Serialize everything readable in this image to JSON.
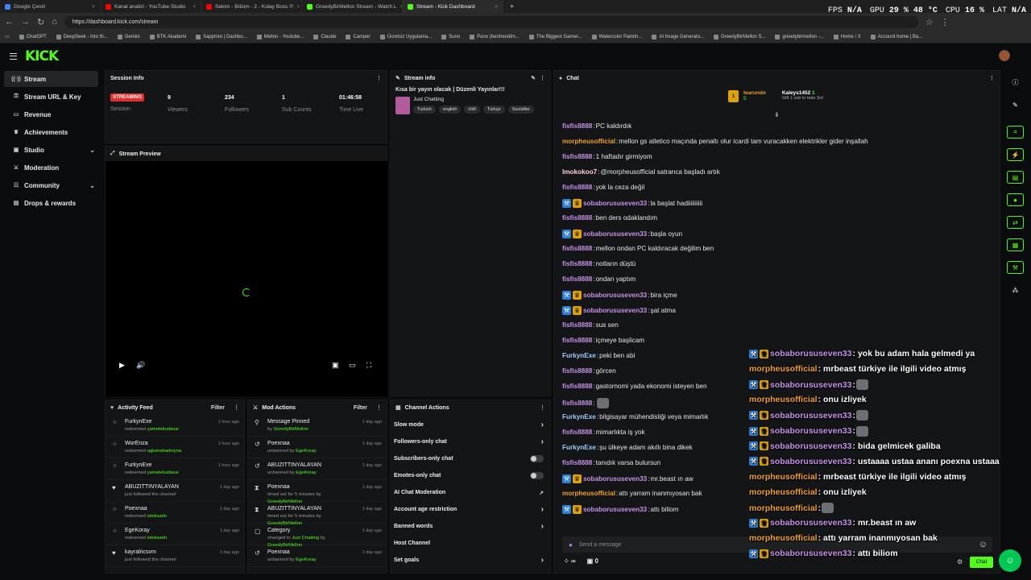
{
  "browser": {
    "tabs": [
      {
        "title": "Google Çeviri",
        "color": "#4285f4"
      },
      {
        "title": "Kanal analizi - YouTube Studio",
        "color": "#ff0000"
      },
      {
        "title": "Sekiro - Bölüm - 2 - Kolay Boss !!!",
        "color": "#ff0000"
      },
      {
        "title": "GreedyBirMellon Stream - Watch L",
        "color": "#53fc18"
      },
      {
        "title": "Stream - Kick Dashboard",
        "color": "#53fc18"
      }
    ],
    "url": "https://dashboard.kick.com/stream",
    "bookmarks": [
      "ChatGPT",
      "DeepSeek - Into th...",
      "Gemini",
      "BTK Akademi",
      "Sapphire | Dashbo...",
      "Mellon - Youtube...",
      "Claude",
      "Camper",
      "Ücretsiz Uygulama...",
      "Suno",
      "Pano (bentrendim...",
      "The Biggest Gamer...",
      "Watercolor Paintin...",
      "AI Image Generato...",
      "GreedyBirMellon S...",
      "greedybirmellon -...",
      "Home / X",
      "Account home | Ba..."
    ]
  },
  "hud": {
    "fps_label": "FPS",
    "fps": "N/A",
    "gpu_label": "GPU",
    "gpu": "29 % 48 °C",
    "cpu_label": "CPU",
    "cpu": "16 %",
    "lat_label": "LAT",
    "lat": "N/A"
  },
  "brand": {
    "logo": "KICK",
    "accent": "#53fc18"
  },
  "sidebar": {
    "items": [
      {
        "label": "Stream",
        "icon": "stream-icon"
      },
      {
        "label": "Stream URL & Key",
        "icon": "key-icon"
      },
      {
        "label": "Revenue",
        "icon": "revenue-icon"
      },
      {
        "label": "Achievements",
        "icon": "trophy-icon"
      },
      {
        "label": "Studio",
        "icon": "studio-icon"
      },
      {
        "label": "Moderation",
        "icon": "sword-icon"
      },
      {
        "label": "Community",
        "icon": "community-icon"
      },
      {
        "label": "Drops & rewards",
        "icon": "gift-icon"
      }
    ]
  },
  "session": {
    "title": "Session Info",
    "status": "STREAMING",
    "status_label": "Session",
    "viewers": "9",
    "viewers_label": "Viewers",
    "followers": "234",
    "followers_label": "Followers",
    "subs": "1",
    "subs_label": "Sub Counts",
    "time": "01:46:58",
    "time_label": "Time Live"
  },
  "stream_info": {
    "title": "Stream info",
    "stream_title": "Kısa bir yayın olacak | Düzenli Yayınlar!!!",
    "category": "Just Chatting",
    "tags": [
      "Turkish",
      "english",
      "chill",
      "Türkçe",
      "Soulslike"
    ]
  },
  "preview": {
    "title": "Stream Preview"
  },
  "activity": {
    "title": "Activity Feed",
    "filter": "Filter",
    "rows": [
      {
        "name": "FurkynExe",
        "pre": "redeemed ",
        "hl": "yametekudasai",
        "time": "1 hour ago",
        "icon": "redeem-icon"
      },
      {
        "name": "WorEnza",
        "pre": "redeemed ",
        "hl": "aglamahadioyna",
        "time": "1 hour ago",
        "icon": "redeem-icon"
      },
      {
        "name": "FurkynExe",
        "pre": "redeemed ",
        "hl": "yametekudasai",
        "time": "1 hour ago",
        "icon": "redeem-icon"
      },
      {
        "name": "ABUZITTINYALAYAN",
        "pre": "just followed the channel",
        "hl": "",
        "time": "1 day ago",
        "icon": "heart-icon"
      },
      {
        "name": "Poexnaa",
        "pre": "redeemed ",
        "hl": "isteksarkı",
        "time": "1 day ago",
        "icon": "redeem-icon"
      },
      {
        "name": "EgeKoray",
        "pre": "redeemed ",
        "hl": "isteksarkı",
        "time": "1 day ago",
        "icon": "redeem-icon"
      },
      {
        "name": "kayralricsvm",
        "pre": "just followed the channel",
        "hl": "",
        "time": "1 day ago",
        "icon": "heart-icon"
      }
    ]
  },
  "mod": {
    "title": "Mod Actions",
    "filter": "Filter",
    "rows": [
      {
        "name": "Message Pinned",
        "pre": "by ",
        "hl": "GreedyBirMellon",
        "time": "1 day ago",
        "icon": "pin-icon"
      },
      {
        "name": "Poexnaa",
        "pre": "unbanned by ",
        "hl": "EgeKoray",
        "time": "1 day ago",
        "icon": "unban-icon"
      },
      {
        "name": "ABUZITTINYALAYAN",
        "pre": "unbanned by ",
        "hl": "EgeKoray",
        "time": "1 day ago",
        "icon": "unban-icon"
      },
      {
        "name": "Poexnaa",
        "pre": "timed out for 5 minutes by ",
        "hl": "GreedyBirMellon",
        "time": "1 day ago",
        "icon": "hourglass-icon"
      },
      {
        "name": "ABUZITTINYALAYAN",
        "pre": "timed out for 5 minutes by ",
        "hl": "GreedyBirMellon",
        "time": "1 day ago",
        "icon": "hourglass-icon"
      },
      {
        "name": "Category",
        "pre": "changed to ",
        "hl": "Just Chatting",
        "pre2": " by ",
        "hl2": "GreedyBirMellon",
        "time": "1 day ago",
        "icon": "category-icon"
      },
      {
        "name": "Poexnaa",
        "pre": "unbanned by ",
        "hl": "EgeKoray",
        "time": "1 day ago",
        "icon": "unban-icon"
      }
    ]
  },
  "channel_actions": {
    "title": "Channel Actions",
    "rows": [
      {
        "label": "Slow mode",
        "ctl": "chevron"
      },
      {
        "label": "Followers-only chat",
        "ctl": "chevron"
      },
      {
        "label": "Subscribers-only chat",
        "ctl": "toggle"
      },
      {
        "label": "Emotes-only chat",
        "ctl": "toggle"
      },
      {
        "label": "AI Chat Moderation",
        "ctl": "external"
      },
      {
        "label": "Account age restriction",
        "ctl": "chevron"
      },
      {
        "label": "Banned words",
        "ctl": "chevron"
      },
      {
        "label": "Host Channel",
        "ctl": "none"
      },
      {
        "label": "Set goals",
        "ctl": "chevron"
      }
    ]
  },
  "chat": {
    "title": "Chat",
    "top_gifter": {
      "rank": "1",
      "name": "tearundo",
      "count": "5"
    },
    "gift_user": {
      "name": "Kaleys1452",
      "count": "1",
      "note": "Gift 1 sub to take 3rd"
    },
    "messages": [
      {
        "user": "fisfis8888",
        "color": "#c792ea",
        "badges": [],
        "text": "PC kaldırdık"
      },
      {
        "user": "morpheusofficial",
        "color": "#f0a020",
        "badges": [],
        "text": "mellon gs atletico maçında penaltı olur icardi tam vuracakken elektrikler gider inşallah"
      },
      {
        "user": "fisfis8888",
        "color": "#c792ea",
        "badges": [],
        "text": "1 haftadır girmiyom"
      },
      {
        "user": "lmokokoo7",
        "color": "#ffd1dc",
        "badges": [],
        "text": "@morpheusofficial satranca başladı artık"
      },
      {
        "user": "fisfis8888",
        "color": "#c792ea",
        "badges": [],
        "text": "yok la ceza değil"
      },
      {
        "user": "sobaborususeven33",
        "color": "#c792ea",
        "badges": [
          "mod",
          "sub"
        ],
        "text": "la başlat hadiiiiiiiiii"
      },
      {
        "user": "fisfis8888",
        "color": "#c792ea",
        "badges": [],
        "text": "ben ders odaklandım"
      },
      {
        "user": "sobaborususeven33",
        "color": "#c792ea",
        "badges": [
          "mod",
          "sub"
        ],
        "text": "başla oyun"
      },
      {
        "user": "fisfis8888",
        "color": "#c792ea",
        "badges": [],
        "text": "mellon ondan PC kaldıracak değilim ben"
      },
      {
        "user": "fisfis8888",
        "color": "#c792ea",
        "badges": [],
        "text": "notların düştü"
      },
      {
        "user": "fisfis8888",
        "color": "#c792ea",
        "badges": [],
        "text": "ondan yaptım"
      },
      {
        "user": "sobaborususeven33",
        "color": "#c792ea",
        "badges": [
          "mod",
          "sub"
        ],
        "text": "bira içme"
      },
      {
        "user": "sobaborususeven33",
        "color": "#c792ea",
        "badges": [
          "mod",
          "sub"
        ],
        "text": "şat atma"
      },
      {
        "user": "fisfis8888",
        "color": "#c792ea",
        "badges": [],
        "text": "sus sen"
      },
      {
        "user": "fisfis8888",
        "color": "#c792ea",
        "badges": [],
        "text": "içmeye başlicam"
      },
      {
        "user": "FurkynExe",
        "color": "#9ecbff",
        "badges": [],
        "text": "peki ben abi"
      },
      {
        "user": "fisfis8888",
        "color": "#c792ea",
        "badges": [],
        "text": "görcen"
      },
      {
        "user": "fisfis8888",
        "color": "#c792ea",
        "badges": [],
        "text": "gastornomi yada ekonomi isteyen ben"
      },
      {
        "user": "fisfis8888",
        "color": "#c792ea",
        "badges": [],
        "text": "",
        "emote": true
      },
      {
        "user": "FurkynExe",
        "color": "#9ecbff",
        "badges": [],
        "text": "bilgisayar mühendisliği veya mimarlık"
      },
      {
        "user": "fisfis8888",
        "color": "#c792ea",
        "badges": [],
        "text": "mimarlıkta iş yok"
      },
      {
        "user": "FurkynExe",
        "color": "#9ecbff",
        "badges": [],
        "text": "şu ülkeye adam akıllı bina dikek"
      },
      {
        "user": "fisfis8888",
        "color": "#c792ea",
        "badges": [],
        "text": "tanıdık varsa bulursun"
      },
      {
        "user": "sobaborususeven33",
        "color": "#c792ea",
        "badges": [
          "mod",
          "sub"
        ],
        "text": "mr.beast ın aw"
      },
      {
        "user": "morpheusofficial",
        "color": "#f0a020",
        "badges": [],
        "text": "attı yarram inanmıyosan bak"
      },
      {
        "user": "sobaborususeven33",
        "color": "#c792ea",
        "badges": [
          "mod",
          "sub"
        ],
        "text": "attı biliom"
      }
    ],
    "input_placeholder": "Send a message",
    "send_label": "Chat",
    "points": "∞",
    "count": "0"
  },
  "overlay": [
    {
      "user": "sobaborususeven33",
      "color": "#c792ea",
      "badges": [
        "mod",
        "sub"
      ],
      "text": " : yok bu adam hala gelmedi ya"
    },
    {
      "user": "morpheusofficial",
      "color": "#f0a020",
      "badges": [],
      "text": " : mrbeast türkiye ile ilgili video atmış"
    },
    {
      "user": "sobaborususeven33",
      "color": "#c792ea",
      "badges": [
        "mod",
        "sub"
      ],
      "text": " : ",
      "emote": true
    },
    {
      "user": "morpheusofficial",
      "color": "#f0a020",
      "badges": [],
      "text": " : onu izliyek"
    },
    {
      "user": "sobaborususeven33",
      "color": "#c792ea",
      "badges": [
        "mod",
        "sub"
      ],
      "text": " : ",
      "emote": true
    },
    {
      "user": "sobaborususeven33",
      "color": "#c792ea",
      "badges": [
        "mod",
        "sub"
      ],
      "text": " : ",
      "emote": true
    },
    {
      "user": "sobaborususeven33",
      "color": "#c792ea",
      "badges": [
        "mod",
        "sub"
      ],
      "text": " : bida gelmicek galiba"
    },
    {
      "user": "sobaborususeven33",
      "color": "#c792ea",
      "badges": [
        "mod",
        "sub"
      ],
      "text": " : ustaaaa ustaa ananı poexna ustaaa"
    },
    {
      "user": "morpheusofficial",
      "color": "#f0a020",
      "badges": [],
      "text": " : mrbeast türkiye ile ilgili video atmış"
    },
    {
      "user": "morpheusofficial",
      "color": "#f0a020",
      "badges": [],
      "text": " : onu izliyek"
    },
    {
      "user": "morpheusofficial",
      "color": "#f0a020",
      "badges": [],
      "text": " : ",
      "emote": true
    },
    {
      "user": "sobaborususeven33",
      "color": "#c792ea",
      "badges": [
        "mod",
        "sub"
      ],
      "text": " : mr.beast ın aw"
    },
    {
      "user": "morpheusofficial",
      "color": "#f0a020",
      "badges": [],
      "text": " : attı yarram inanmıyosan bak"
    },
    {
      "user": "sobaborususeven33",
      "color": "#c792ea",
      "badges": [
        "mod",
        "sub"
      ],
      "text": " : attı biliom"
    }
  ],
  "rightbar": [
    "info-icon",
    "edit-icon",
    "crop-icon",
    "lightning-icon",
    "clipboard-icon",
    "chat-bubble-icon",
    "raid-icon",
    "calendar-icon",
    "wrench-icon",
    "users-icon"
  ]
}
